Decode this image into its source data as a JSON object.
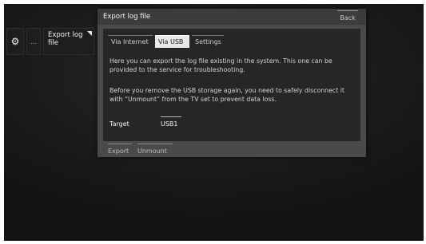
{
  "breadcrumb": {
    "settings_icon": "gear-icon",
    "more_label": "...",
    "current_label": "Export log file"
  },
  "dialog": {
    "title": "Export log file",
    "back_label": "Back",
    "tabs": [
      {
        "label": "Via Internet",
        "active": false
      },
      {
        "label": "Via USB",
        "active": true
      },
      {
        "label": "Settings",
        "active": false
      }
    ],
    "paragraph1": "Here you can export the log file existing in the system. This one can be provided to the service for troubleshooting.",
    "paragraph2": "Before you remove the USB storage again, you need to safely disconnect it with “Unmount” from the TV set to prevent data loss.",
    "target_label": "Target",
    "target_value": "USB1",
    "buttons": {
      "export": "Export",
      "unmount": "Unmount"
    }
  },
  "colors": {
    "background": "#1c1c1c",
    "dialog": "#4a4a4a",
    "content": "#262626",
    "active_tab": "#e8e8e8"
  }
}
